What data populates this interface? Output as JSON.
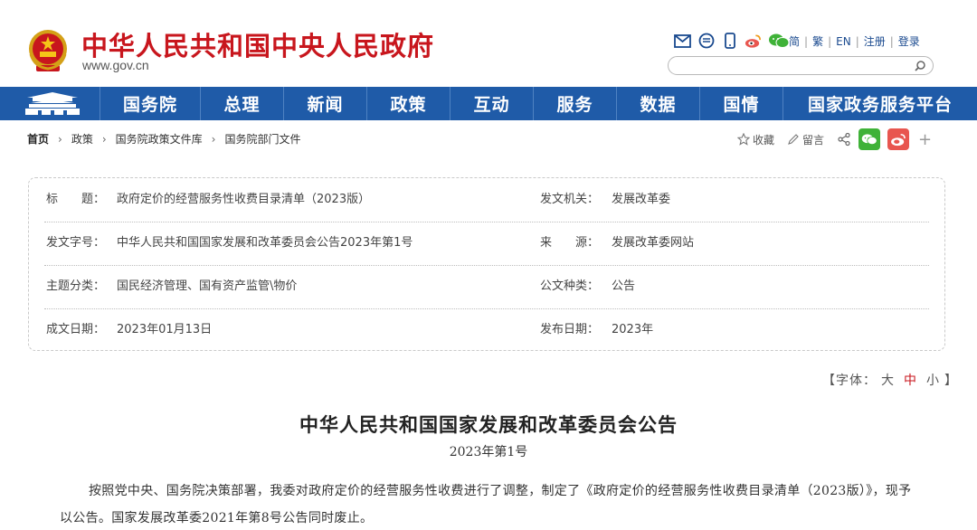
{
  "header": {
    "site_title": "中华人民共和国中央人民政府",
    "site_url": "www.gov.cn",
    "top_links": [
      "简",
      "繁",
      "EN",
      "注册",
      "登录"
    ],
    "search_placeholder": ""
  },
  "nav": {
    "items": [
      "国务院",
      "总理",
      "新闻",
      "政策",
      "互动",
      "服务",
      "数据",
      "国情",
      "国家政务服务平台"
    ]
  },
  "breadcrumb": {
    "home": "首页",
    "items": [
      "政策",
      "国务院政策文件库",
      "国务院部门文件"
    ]
  },
  "share": {
    "collect": "收藏",
    "comment": "留言",
    "plus": "+"
  },
  "info": {
    "rows": [
      {
        "l1": "标　　题：",
        "v1": "政府定价的经营服务性收费目录清单（2023版）",
        "l2": "发文机关：",
        "v2": "发展改革委"
      },
      {
        "l1": "发文字号：",
        "v1": "中华人民共和国国家发展和改革委员会公告2023年第1号",
        "l2": "来　　源：",
        "v2": "发展改革委网站"
      },
      {
        "l1": "主题分类：",
        "v1": "国民经济管理、国有资产监管\\物价",
        "l2": "公文种类：",
        "v2": "公告"
      },
      {
        "l1": "成文日期：",
        "v1": "2023年01月13日",
        "l2": "发布日期：",
        "v2": "2023年"
      }
    ]
  },
  "fontsize": {
    "open": "【字体：",
    "large": "大",
    "medium": "中",
    "small": "小",
    "close": "】"
  },
  "article": {
    "title": "中华人民共和国国家发展和改革委员会公告",
    "subtitle": "2023年第1号",
    "body": "按照党中央、国务院决策部署，我委对政府定价的经营服务性收费进行了调整，制定了《政府定价的经营服务性收费目录清单（2023版）》，现予以公告。国家发展改革委2021年第8号公告同时废止。"
  },
  "colors": {
    "brand_red": "#c8161d",
    "nav_blue": "#1f5ba8",
    "wechat_green": "#3fb238",
    "weibo_orange": "#e8564f"
  }
}
